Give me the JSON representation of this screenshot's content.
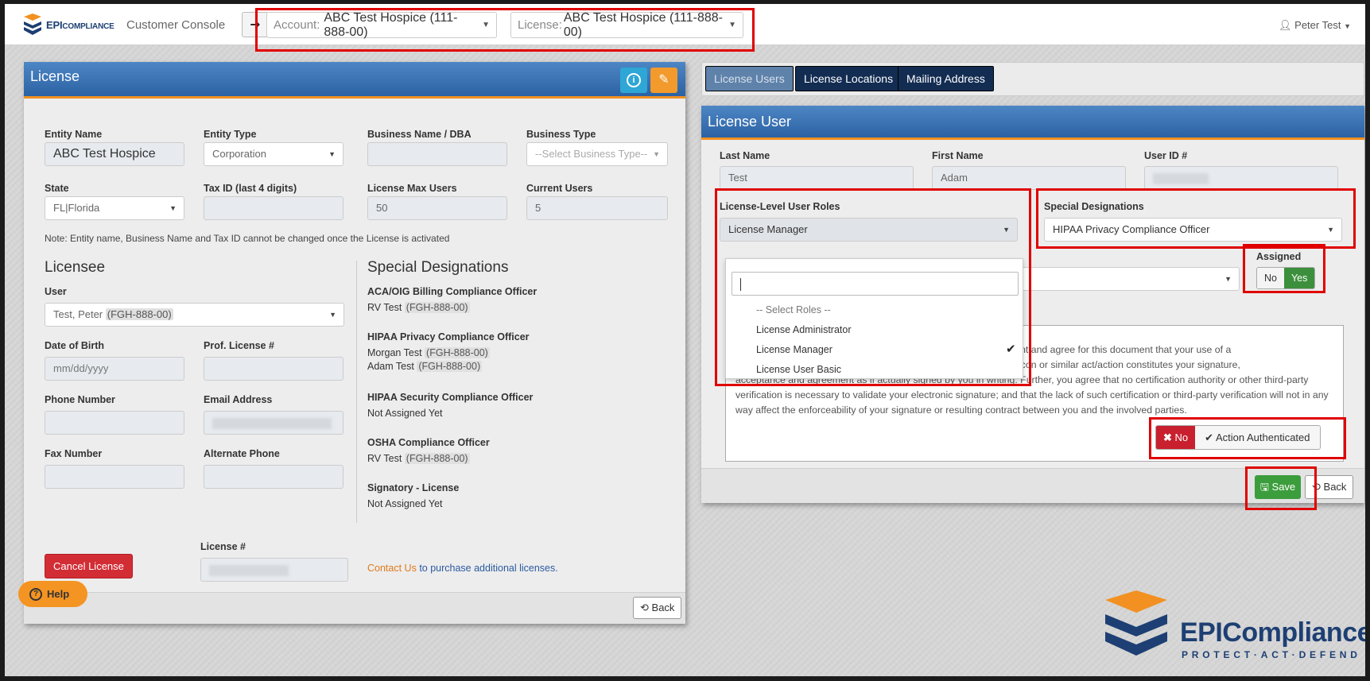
{
  "app": {
    "brand_main": "EPI",
    "brand_rest": "COMPLIANCE",
    "console_title": "Customer Console",
    "user_name": "Peter Test"
  },
  "header": {
    "account_label": "Account:",
    "account_value": "ABC Test Hospice (111-888-00)",
    "license_label": "License:",
    "license_value": "ABC Test Hospice (111-888-00)"
  },
  "license_panel": {
    "title": "License",
    "fields": {
      "entity_name_label": "Entity Name",
      "entity_name_value": "ABC Test Hospice",
      "entity_type_label": "Entity Type",
      "entity_type_value": "Corporation",
      "business_name_label": "Business Name / DBA",
      "business_type_label": "Business Type",
      "business_type_placeholder": "--Select Business Type--",
      "state_label": "State",
      "state_value": "FL|Florida",
      "tax_id_label": "Tax ID (last 4 digits)",
      "max_users_label": "License Max Users",
      "max_users_value": "50",
      "current_users_label": "Current Users",
      "current_users_value": "5"
    },
    "note": "Note: Entity name, Business Name and Tax ID cannot be changed once the License is activated",
    "licensee": {
      "heading": "Licensee",
      "user_label": "User",
      "user_value": "Test, Peter",
      "user_tag": "(FGH-888-00)",
      "dob_label": "Date of Birth",
      "dob_placeholder": "mm/dd/yyyy",
      "prof_license_label": "Prof. License #",
      "phone_label": "Phone Number",
      "email_label": "Email Address",
      "fax_label": "Fax Number",
      "alt_phone_label": "Alternate Phone",
      "license_num_label": "License #"
    },
    "special_designations": {
      "heading": "Special Designations",
      "items": [
        {
          "title": "ACA/OIG Billing Compliance Officer",
          "people": [
            {
              "name": "RV Test",
              "tag": "(FGH-888-00)"
            }
          ]
        },
        {
          "title": "HIPAA Privacy Compliance Officer",
          "people": [
            {
              "name": "Morgan Test",
              "tag": "(FGH-888-00)"
            },
            {
              "name": "Adam Test",
              "tag": "(FGH-888-00)"
            }
          ]
        },
        {
          "title": "HIPAA Security Compliance Officer",
          "people": [
            {
              "name": "Not Assigned Yet",
              "tag": ""
            }
          ]
        },
        {
          "title": "OSHA Compliance Officer",
          "people": [
            {
              "name": "RV Test",
              "tag": "(FGH-888-00)"
            }
          ]
        },
        {
          "title": "Signatory - License",
          "people": [
            {
              "name": "Not Assigned Yet",
              "tag": ""
            }
          ]
        }
      ]
    },
    "cancel_label": "Cancel License",
    "contact_link": "Contact Us",
    "contact_rest": " to purchase additional licenses.",
    "back_label": "Back"
  },
  "tabs": [
    {
      "label": "License Users",
      "active": true
    },
    {
      "label": "License Locations",
      "active": false
    },
    {
      "label": "Mailing Address",
      "active": false
    }
  ],
  "license_user": {
    "title": "License User",
    "last_name_label": "Last Name",
    "last_name_value": "Test",
    "first_name_label": "First Name",
    "first_name_value": "Adam",
    "user_id_label": "User ID #",
    "roles_label": "License-Level User Roles",
    "roles_value": "License Manager",
    "roles_options": [
      "-- Select Roles --",
      "License Administrator",
      "License Manager",
      "License User Basic"
    ],
    "roles_selected_index": 2,
    "designations_label": "Special Designations",
    "designations_value": "HIPAA Privacy Compliance Officer",
    "assigned_label": "Assigned",
    "assigned_no": "No",
    "assigned_yes": "Yes",
    "consent_text_line1": "u consent and agree for this document that your use of a",
    "consent_text_line2": "button, icon or similar act/action constitutes your signature,",
    "consent_text_rest": "acceptance and agreement as if actually signed by you in writing. Further, you agree that no certification authority or other third-party verification is necessary to validate your electronic signature; and that the lack of such certification or third-party verification will not in any way affect the enforceability of your signature or resulting contract between you and the involved parties.",
    "auth_no": "No",
    "auth_label": "Action Authenticated",
    "save_label": "Save",
    "back_label": "Back"
  },
  "help_label": "Help",
  "footer_logo": {
    "main": "EPICompliance",
    "tagline": "PROTECT·ACT·DEFEND"
  },
  "colors": {
    "brand_blue": "#1c3f72",
    "header_blue": "#2c62a3",
    "accent_orange": "#f29121",
    "highlight_red": "#e00000",
    "save_green": "#3c9d3c"
  }
}
